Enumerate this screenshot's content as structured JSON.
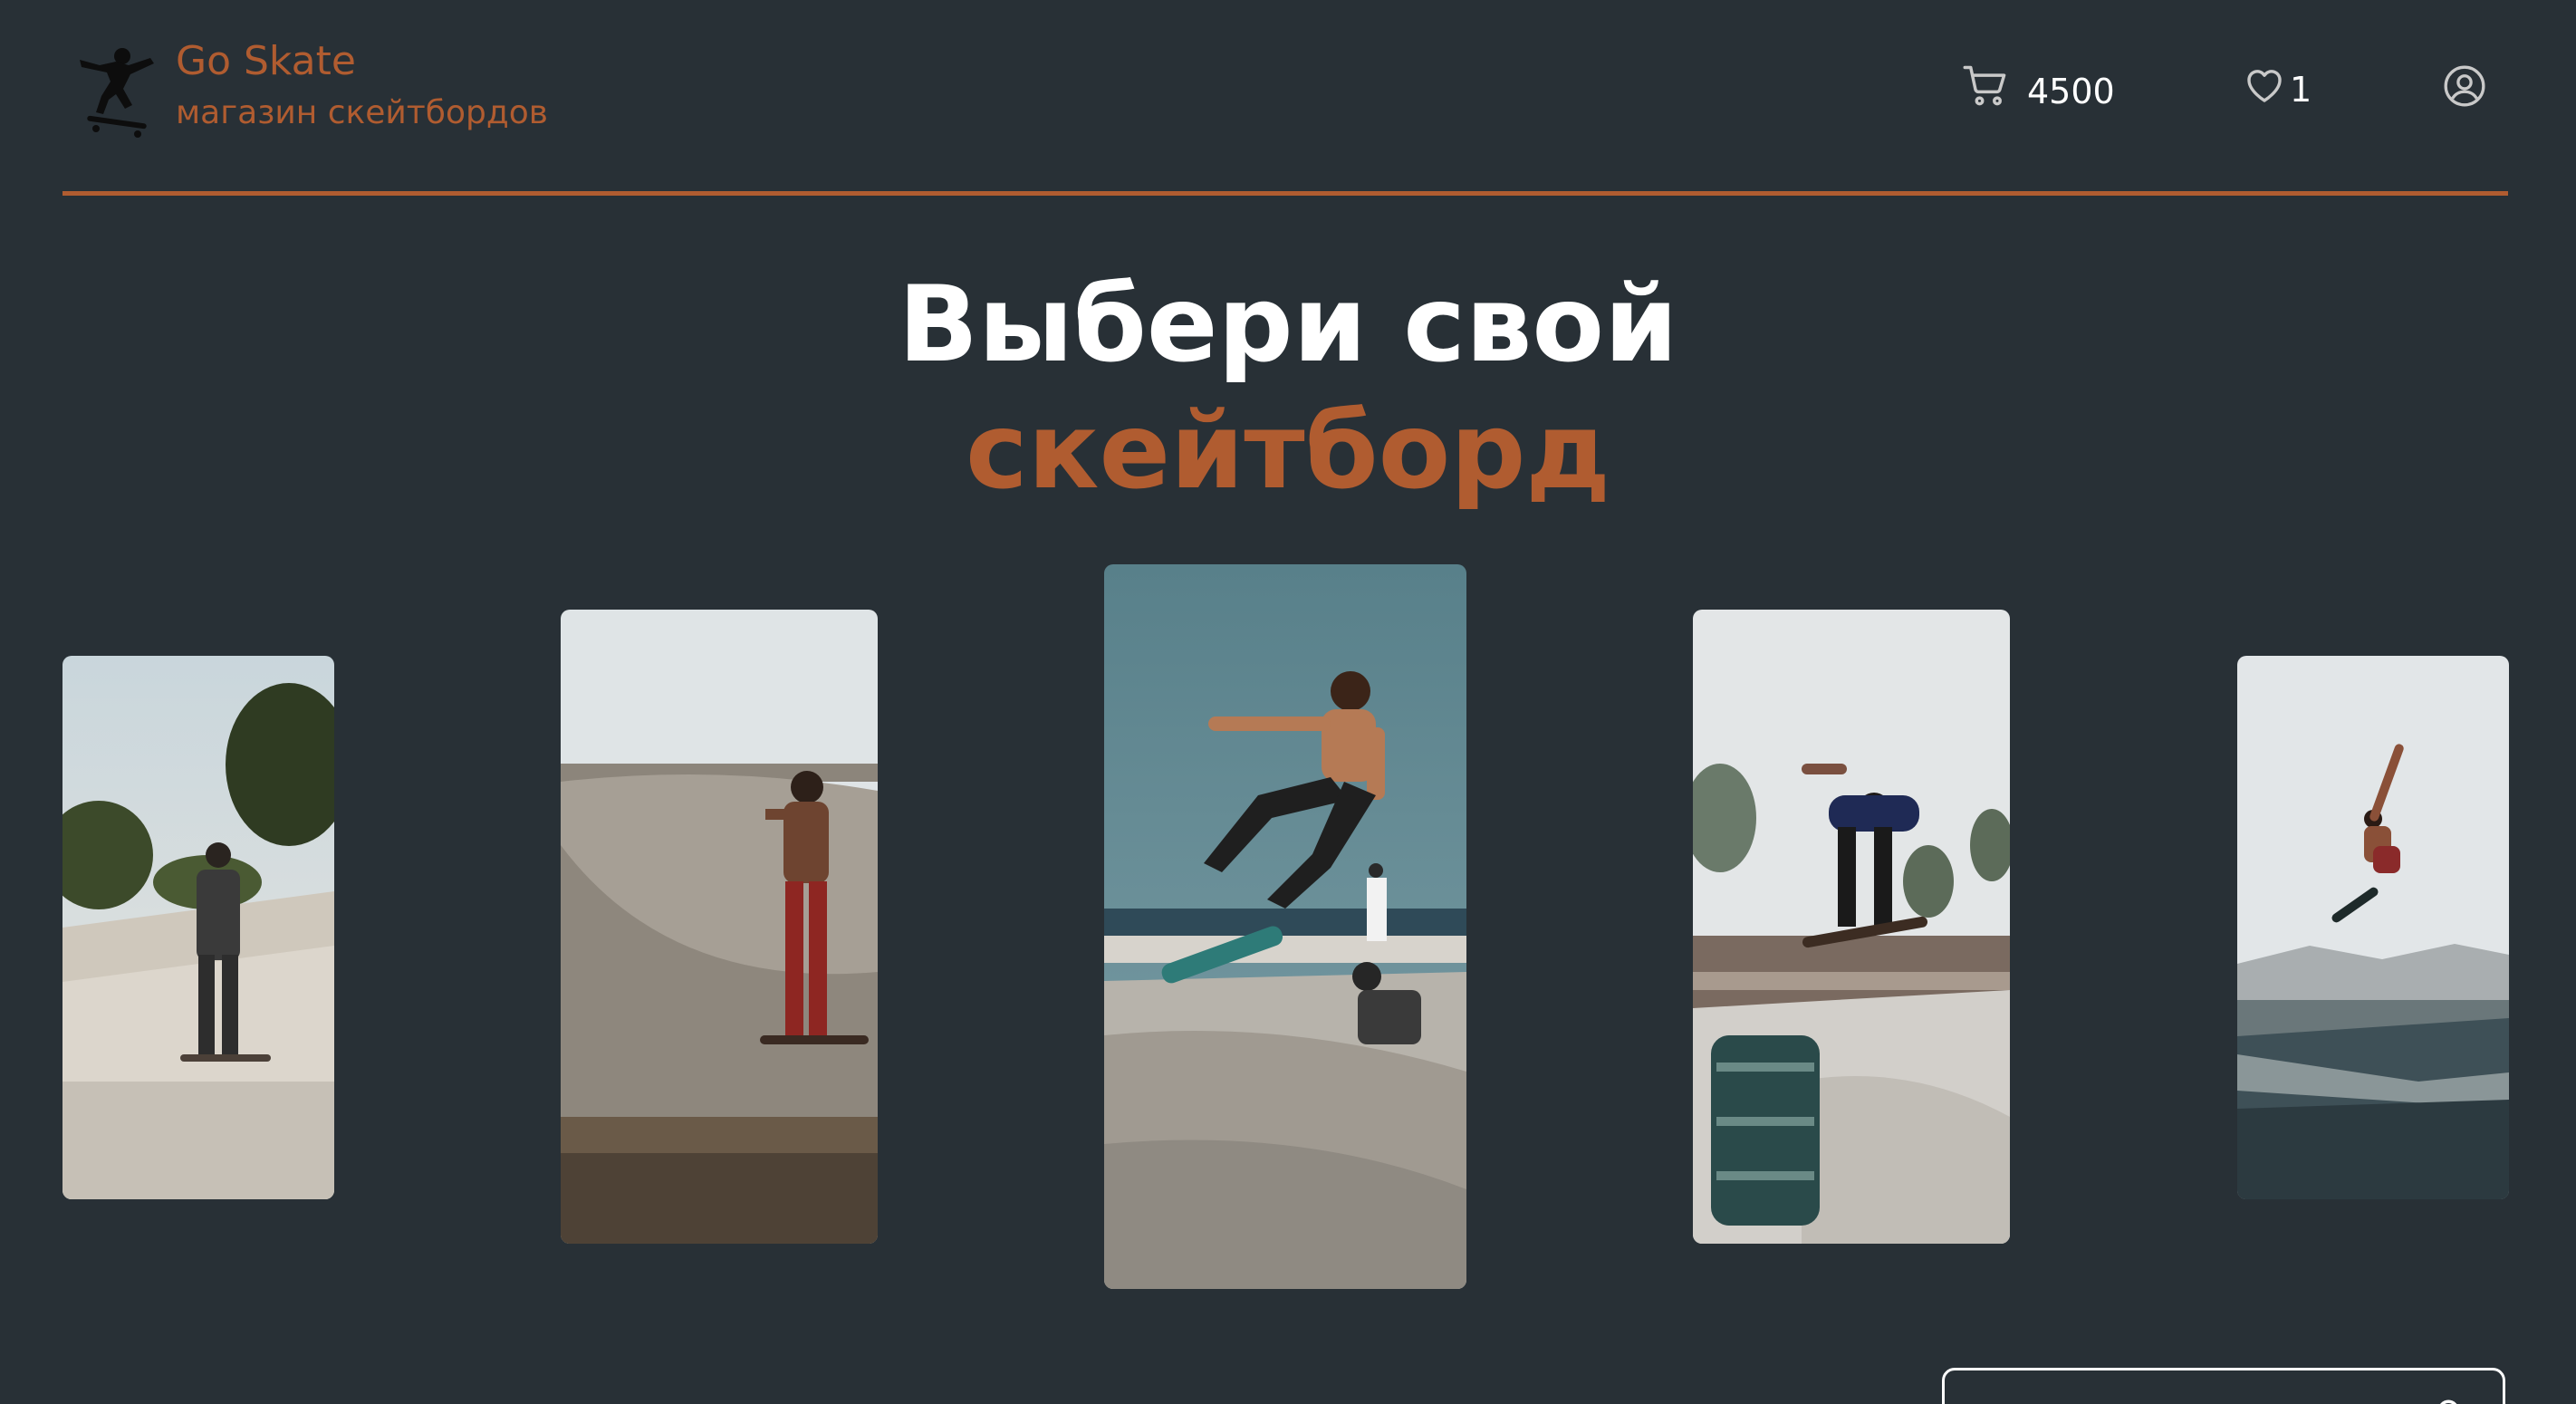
{
  "header": {
    "brand_title": "Go Skate",
    "brand_subtitle": "магазин скейтбордов",
    "cart_total": "4500",
    "favorites_count": "1",
    "logo_icon": "skater-logo-icon",
    "cart_icon": "cart-icon",
    "favorites_icon": "heart-icon",
    "profile_icon": "user-circle-icon"
  },
  "hero": {
    "line1": "Выбери свой",
    "line2": "скейтборд"
  },
  "carousel": {
    "slides": [
      "skater-standing-photo",
      "skater-bowl-photo",
      "skater-jump-photo",
      "skater-crowd-trick-photo",
      "skater-air-photo"
    ]
  },
  "colors": {
    "background": "#283036",
    "accent": "#b05c30",
    "text": "#ffffff"
  }
}
